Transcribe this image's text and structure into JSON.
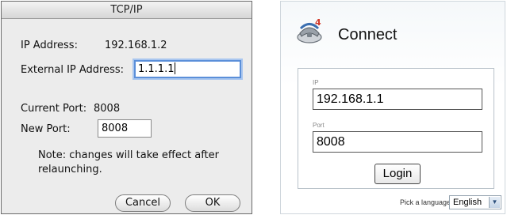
{
  "mac_dialog": {
    "title": "TCP/IP",
    "ip_label": "IP Address:",
    "ip_value": "192.168.1.2",
    "external_ip_label": "External IP Address:",
    "external_ip_value": "1.1.1.1",
    "current_port_label": "Current Port:",
    "current_port_value": "8008",
    "new_port_label": "New Port:",
    "new_port_value": "8008",
    "note": "Note: changes will take effect after relaunching.",
    "cancel_label": "Cancel",
    "ok_label": "OK"
  },
  "web_login": {
    "title": "Connect",
    "ip_label": "IP",
    "ip_value": "192.168.1.1",
    "port_label": "Port",
    "port_value": "8008",
    "login_label": "Login",
    "language_label": "Pick a language:",
    "language_value": "English",
    "icon": "connect-phone-icon",
    "icon_badge": "4"
  }
}
